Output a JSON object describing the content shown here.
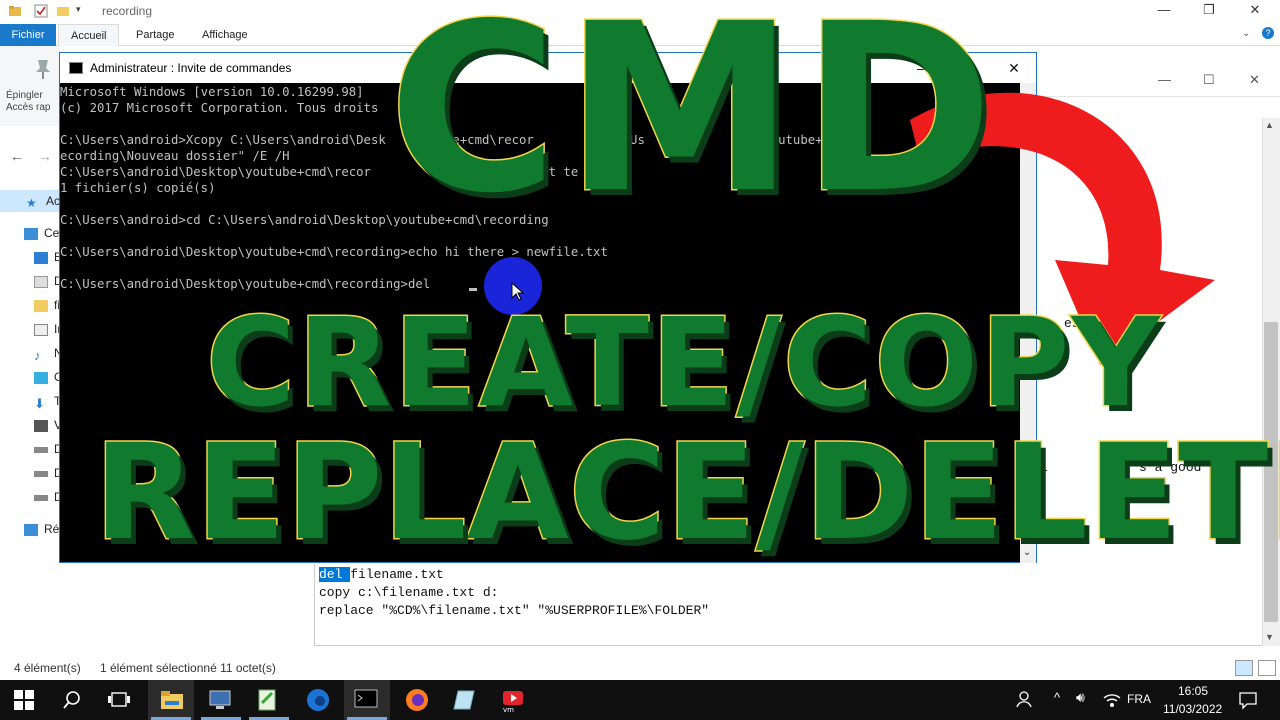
{
  "explorer": {
    "path": "recording",
    "tabs": [
      "Fichier",
      "Accueil",
      "Partage",
      "Affichage"
    ],
    "pin_label_1": "Épingler",
    "pin_label_2": "Accès rap",
    "sidebar": [
      "Ac",
      "Ce",
      "B",
      "D",
      "fi",
      "Ir",
      "N",
      "O",
      "T",
      "V",
      "D",
      "D",
      "D",
      "Ré"
    ],
    "status_items": "4 élément(s)",
    "status_selected": "1 élément sélectionné  11 octet(s)"
  },
  "notepad": {
    "fragment_1": "es n",
    "fragment_2": "i",
    "fragment_3": ",    s a good",
    "line_1_highlight": "del ",
    "line_1_rest": "filename.txt",
    "line_2": "copy c:\\filename.txt d:",
    "line_3": "replace \"%CD%\\filename.txt\" \"%USERPROFILE%\\FOLDER\""
  },
  "cmd": {
    "title": "Administrateur : Invite de commandes",
    "lines": [
      "Microsoft Windows [version 10.0.16299.98]",
      "(c) 2017 Microsoft Corporation. Tous droits",
      "",
      "C:\\Users\\android>Xcopy C:\\Users\\android\\Desk   youtube+cmd\\recor          C:\\Us   ndro     top\\youtube+cmd\\r",
      "ecording\\Nouveau dossier\" /E /H",
      "C:\\Users\\android\\Desktop\\youtube+cmd\\recor         Nouve       ment te    xt",
      "1 fichier(s) copié(s)",
      "",
      "C:\\Users\\android>cd C:\\Users\\android\\Desktop\\youtube+cmd\\recording",
      "",
      "C:\\Users\\android\\Desktop\\youtube+cmd\\recording>echo hi there > newfile.txt",
      "",
      "C:\\Users\\android\\Desktop\\youtube+cmd\\recording>del"
    ]
  },
  "overlay": {
    "title": "CMD",
    "line1": "CREATE/COPY",
    "line2": "REPLACE/DELETE"
  },
  "taskbar": {
    "lang": "FRA",
    "time": "16:05",
    "date": "11/03/2022"
  },
  "colors": {
    "overlay_green": "#107a2e",
    "overlay_outline": "#f1d54b",
    "arrow_red": "#ee1c1c",
    "selection_blue": "#0078d7"
  }
}
